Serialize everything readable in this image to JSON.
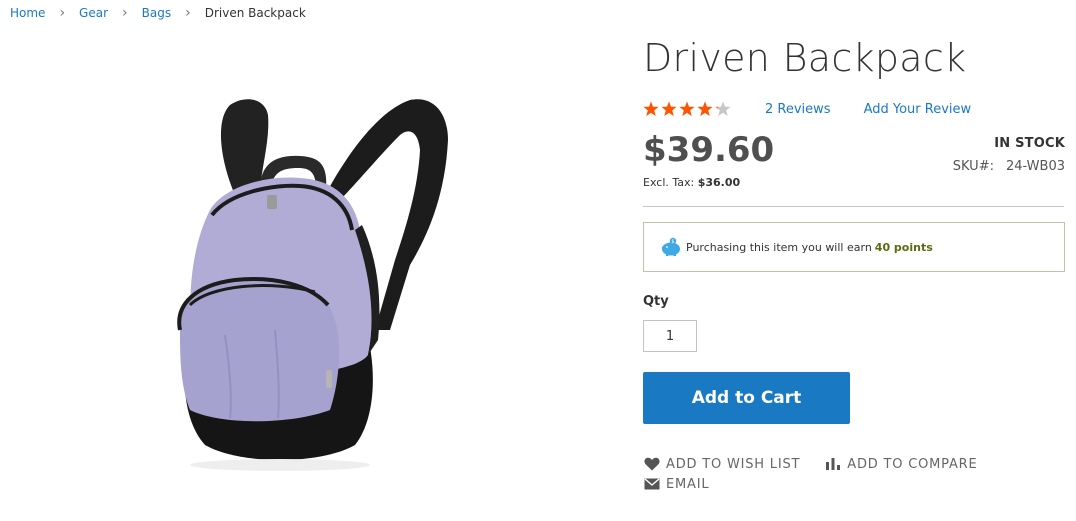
{
  "breadcrumbs": [
    {
      "label": "Home"
    },
    {
      "label": "Gear"
    },
    {
      "label": "Bags"
    },
    {
      "label": "Driven Backpack"
    }
  ],
  "product": {
    "name": "Driven Backpack",
    "rating_fraction": 0.85,
    "reviews_count_label": "2  Reviews",
    "add_review_label": "Add Your Review",
    "price": "$39.60",
    "excl_tax_label": "Excl. Tax:",
    "excl_tax_value": "$36.00",
    "stock_status": "IN STOCK",
    "sku_label": "SKU#:",
    "sku_value": "24-WB03"
  },
  "reward_points": {
    "text": "Purchasing this item you will earn",
    "points": "40 points",
    "icon": "piggy-bank-icon"
  },
  "qty": {
    "label": "Qty",
    "value": "1"
  },
  "buttons": {
    "add_to_cart": "Add to Cart",
    "wish_list": "Add to Wish List",
    "compare": "Add to Compare",
    "email": "Email"
  },
  "colors": {
    "accent": "#1979c3",
    "star": "#ff5501",
    "star_empty": "#c7c7c7"
  }
}
